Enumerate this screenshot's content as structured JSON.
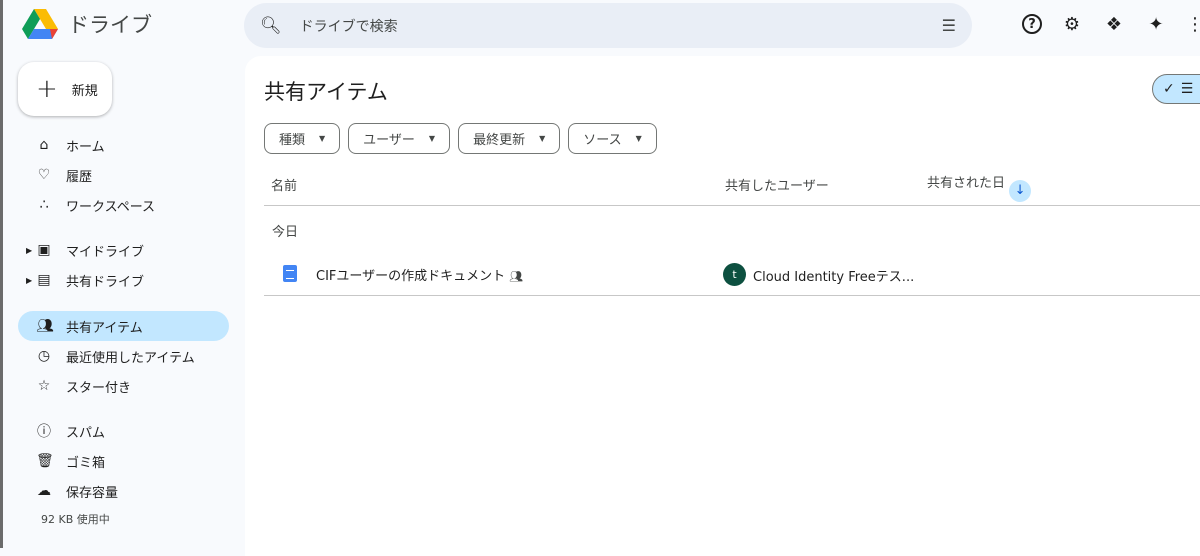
{
  "app": {
    "title": "ドライブ"
  },
  "search": {
    "placeholder": "ドライブで検索"
  },
  "new_button": "新規",
  "nav": [
    {
      "label": "ホーム",
      "icon": "home-icon"
    },
    {
      "label": "履歴",
      "icon": "bell-icon"
    },
    {
      "label": "ワークスペース",
      "icon": "workspaces-icon"
    },
    {
      "label": "マイドライブ",
      "icon": "my-drive-icon"
    },
    {
      "label": "共有ドライブ",
      "icon": "shared-drives-icon"
    },
    {
      "label": "共有アイテム",
      "icon": "people-icon"
    },
    {
      "label": "最近使用したアイテム",
      "icon": "clock-icon"
    },
    {
      "label": "スター付き",
      "icon": "star-icon"
    },
    {
      "label": "スパム",
      "icon": "spam-icon"
    },
    {
      "label": "ゴミ箱",
      "icon": "trash-icon"
    },
    {
      "label": "保存容量",
      "icon": "cloud-icon"
    }
  ],
  "storage": "92 KB 使用中",
  "page_title": "共有アイテム",
  "filters": [
    "種類",
    "ユーザー",
    "最終更新",
    "ソース"
  ],
  "columns": {
    "name": "名前",
    "shared_by": "共有したユーザー",
    "shared_date": "共有された日"
  },
  "group": "今日",
  "rows": [
    {
      "name": "CIFユーザーの作成ドキュメント",
      "avatar": "t",
      "owner": "Cloud Identity Freeテス..."
    }
  ]
}
